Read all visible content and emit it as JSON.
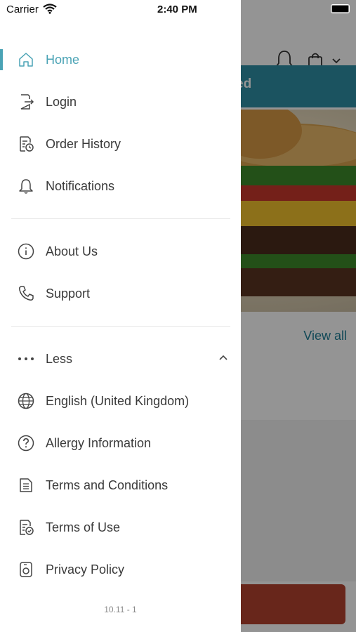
{
  "status_bar": {
    "carrier": "Carrier",
    "time": "2:40 PM"
  },
  "background": {
    "banner_text": "ed",
    "view_all_label": "View all",
    "icons": [
      "bell-icon",
      "shopping-bag-icon",
      "chevron-down-icon"
    ]
  },
  "drawer": {
    "section1": [
      {
        "label": "Home",
        "icon": "home-icon",
        "active": true
      },
      {
        "label": "Login",
        "icon": "login-icon"
      },
      {
        "label": "Order History",
        "icon": "receipt-clock-icon"
      },
      {
        "label": "Notifications",
        "icon": "bell-icon"
      }
    ],
    "section2": [
      {
        "label": "About Us",
        "icon": "info-icon"
      },
      {
        "label": "Support",
        "icon": "phone-icon"
      }
    ],
    "section3": [
      {
        "label": "Less",
        "icon": "more-dots-icon"
      },
      {
        "label": "English (United Kingdom)",
        "icon": "globe-icon"
      },
      {
        "label": "Allergy Information",
        "icon": "question-circle-icon"
      },
      {
        "label": "Terms and Conditions",
        "icon": "document-icon"
      },
      {
        "label": "Terms of Use",
        "icon": "document-check-icon"
      },
      {
        "label": "Privacy Policy",
        "icon": "privacy-icon"
      }
    ],
    "version": "10.11 - 1"
  },
  "colors": {
    "accent": "#4aa3b5",
    "text": "#3a3a3a",
    "banner": "#2f8fa5",
    "cta": "#b4432f"
  }
}
